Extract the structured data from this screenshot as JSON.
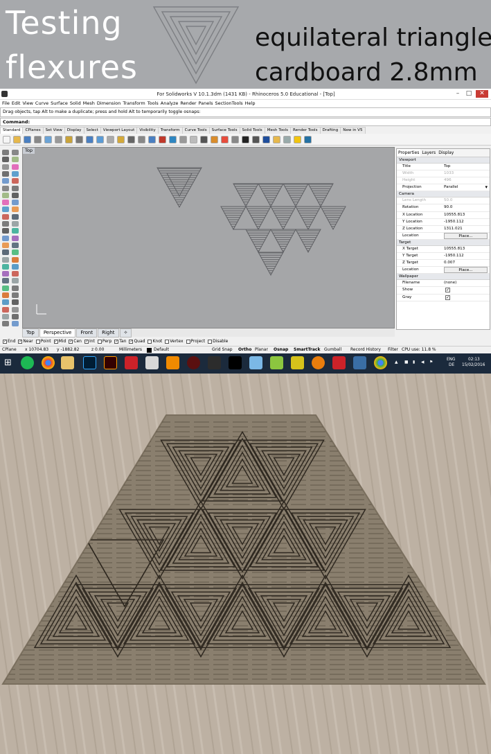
{
  "banner": {
    "line1": "Testing",
    "line2": "flexures",
    "line3": "equilateral triangle",
    "line4": "cardboard 2.8mm"
  },
  "app": {
    "window_title": "For Solidworks V 10.1.3dm (1431 KB) - Rhinoceros 5.0 Educational - [Top]",
    "window_buttons": {
      "minimize": "–",
      "maximize": "□",
      "close": "✕"
    },
    "menu": [
      "File",
      "Edit",
      "View",
      "Curve",
      "Surface",
      "Solid",
      "Mesh",
      "Dimension",
      "Transform",
      "Tools",
      "Analyze",
      "Render",
      "Panels",
      "SectionTools",
      "Help"
    ],
    "history_text": "Drag objects, tap Alt to make a duplicate; press and hold Alt to temporarily toggle osnaps:",
    "command_label": "Command:",
    "toolbar_tabs": [
      "Standard",
      "CPlanes",
      "Set View",
      "Display",
      "Select",
      "Viewport Layout",
      "Visibility",
      "Transform",
      "Curve Tools",
      "Surface Tools",
      "Solid Tools",
      "Mesh Tools",
      "Render Tools",
      "Drafting",
      "New in V5"
    ],
    "viewport_label": "Top",
    "viewport_tabs": [
      "Top",
      "Perspective",
      "Front",
      "Right",
      "✧"
    ],
    "panel": {
      "tabs": [
        "Properties",
        "Layers",
        "Display"
      ],
      "sections": [
        {
          "title": "Viewport",
          "rows": [
            {
              "key": "Title",
              "value": "Top",
              "disabled": false
            },
            {
              "key": "Width",
              "value": "1033",
              "disabled": true
            },
            {
              "key": "Height",
              "value": "496",
              "disabled": true
            },
            {
              "key": "Projection",
              "value": "Parallel",
              "disabled": false,
              "dropdown": true
            }
          ]
        },
        {
          "title": "Camera",
          "rows": [
            {
              "key": "Lens Length",
              "value": "50.0",
              "disabled": true
            },
            {
              "key": "Rotation",
              "value": "90.0",
              "disabled": false
            },
            {
              "key": "X Location",
              "value": "10555.813",
              "disabled": false
            },
            {
              "key": "Y Location",
              "value": "-1950.112",
              "disabled": false
            },
            {
              "key": "Z Location",
              "value": "1311.021",
              "disabled": false
            },
            {
              "key": "Location",
              "value": "Place...",
              "disabled": false,
              "button": true
            }
          ]
        },
        {
          "title": "Target",
          "rows": [
            {
              "key": "X Target",
              "value": "10555.813",
              "disabled": false
            },
            {
              "key": "Y Target",
              "value": "-1950.112",
              "disabled": false
            },
            {
              "key": "Z Target",
              "value": "0.007",
              "disabled": false
            },
            {
              "key": "Location",
              "value": "Place...",
              "disabled": false,
              "button": true
            }
          ]
        },
        {
          "title": "Wallpaper",
          "rows": [
            {
              "key": "Filename",
              "value": "(none)",
              "disabled": false
            },
            {
              "key": "Show",
              "value": "✓",
              "disabled": false,
              "checkbox": true
            },
            {
              "key": "Gray",
              "value": "✓",
              "disabled": false,
              "checkbox": true
            }
          ]
        }
      ]
    },
    "osnaps": [
      {
        "label": "End",
        "checked": true
      },
      {
        "label": "Near",
        "checked": true
      },
      {
        "label": "Point",
        "checked": false
      },
      {
        "label": "Mid",
        "checked": true
      },
      {
        "label": "Cen",
        "checked": true
      },
      {
        "label": "Int",
        "checked": true
      },
      {
        "label": "Perp",
        "checked": false
      },
      {
        "label": "Tan",
        "checked": true
      },
      {
        "label": "Quad",
        "checked": true
      },
      {
        "label": "Knot",
        "checked": false
      },
      {
        "label": "Vertex",
        "checked": false
      },
      {
        "label": "Project",
        "checked": false
      },
      {
        "label": "Disable",
        "checked": false
      }
    ],
    "status": {
      "cplane": "CPlane",
      "x": "x 10704.83",
      "y": "y -1882.82",
      "z": "z 0.00",
      "units": "Millimeters",
      "layer": "Default",
      "grid_snap": "Grid Snap",
      "ortho": "Ortho",
      "planar": "Planar",
      "osnap": "Osnap",
      "smarttrack": "SmartTrack",
      "gumball": "Gumball",
      "record_history": "Record History",
      "filter": "Filter",
      "cpu": "CPU use: 11.8 %"
    },
    "taskbar": {
      "lang_line1": "ENG",
      "lang_line2": "DE",
      "time": "02:13",
      "date": "15/02/2016"
    }
  },
  "colors": {
    "banner_bg": "#a7a9ac",
    "viewport_bg": "#a5a6a8",
    "taskbar_bg": "#1b2a3c",
    "cardboard": "#8a7f6e",
    "table_wood": "#bdb1a3"
  }
}
